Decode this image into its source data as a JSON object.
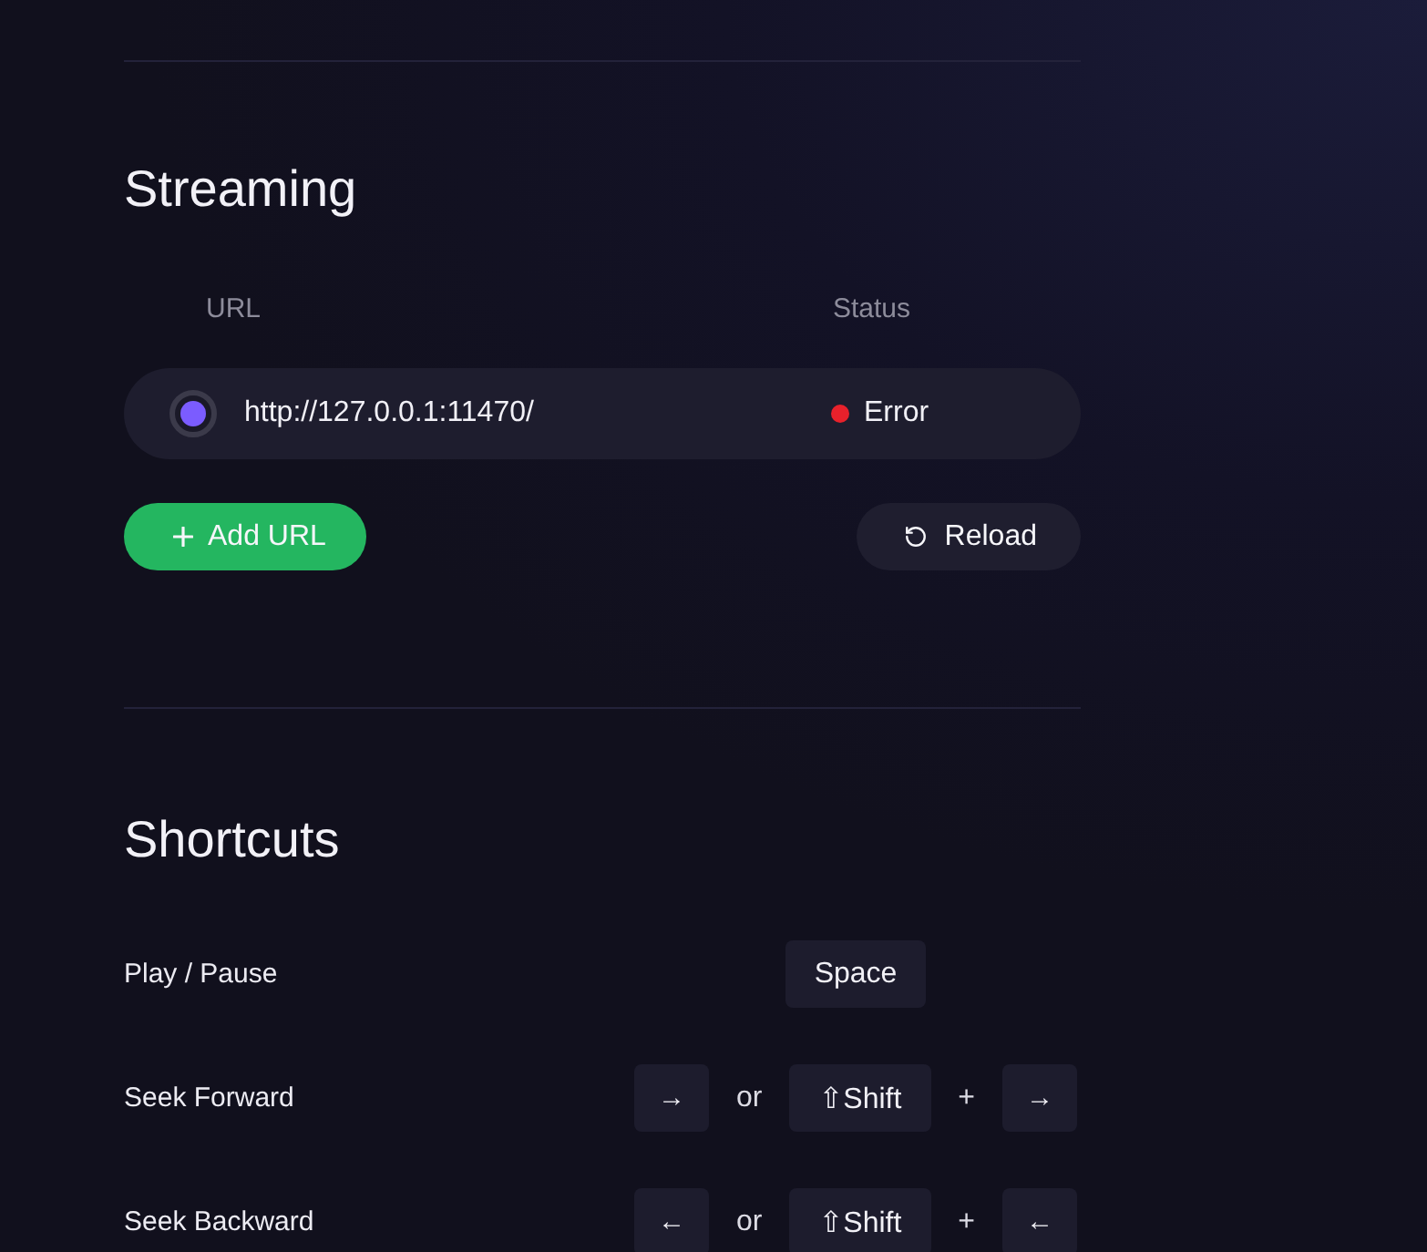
{
  "streaming": {
    "title": "Streaming",
    "columns": [
      "URL",
      "Status"
    ],
    "rows": [
      {
        "url": "http://127.0.0.1:11470/",
        "selected": true,
        "status": "Error",
        "color": "#e8212b"
      }
    ],
    "buttons": [
      {
        "kind": "add",
        "label": "Add URL"
      },
      {
        "kind": "reload",
        "label": "Reload"
      }
    ]
  },
  "shortcuts": {
    "title": "Shortcuts",
    "items": [
      {
        "label": "Play / Pause",
        "keys": [
          {
            "kind": "key",
            "text": "Space"
          }
        ]
      },
      {
        "label": "Seek Forward",
        "keys": [
          {
            "kind": "key",
            "text": "→"
          },
          {
            "kind": "word",
            "text": "or"
          },
          {
            "kind": "key",
            "text": "⇧Shift"
          },
          {
            "kind": "word",
            "text": "+"
          },
          {
            "kind": "key",
            "text": "→"
          }
        ]
      },
      {
        "label": "Seek Backward",
        "keys": [
          {
            "kind": "key",
            "text": "←"
          },
          {
            "kind": "word",
            "text": "or"
          },
          {
            "kind": "key",
            "text": "⇧Shift"
          },
          {
            "kind": "word",
            "text": "+"
          },
          {
            "kind": "key",
            "text": "←"
          }
        ]
      }
    ]
  }
}
